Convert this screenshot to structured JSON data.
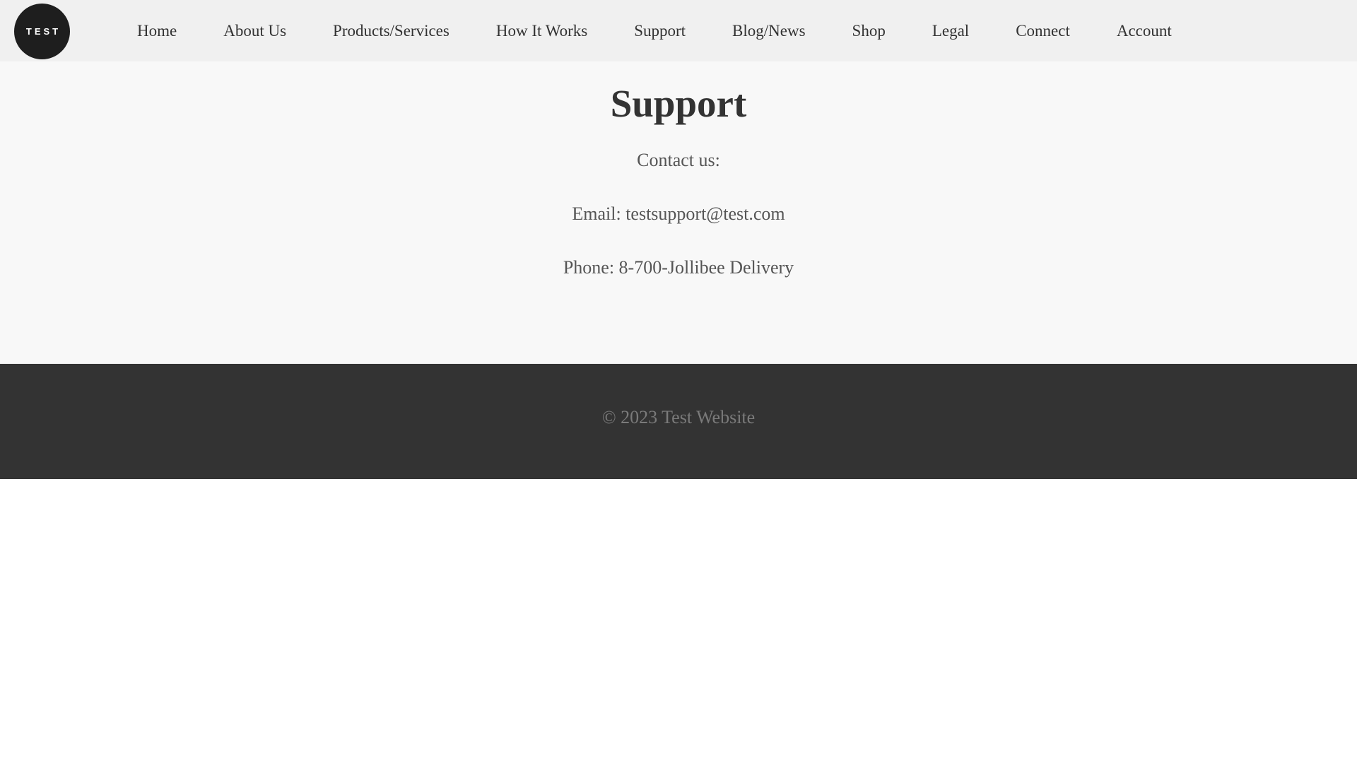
{
  "header": {
    "logo_text": "TEST",
    "nav": [
      {
        "label": "Home"
      },
      {
        "label": "About Us"
      },
      {
        "label": "Products/Services"
      },
      {
        "label": "How It Works"
      },
      {
        "label": "Support"
      },
      {
        "label": "Blog/News"
      },
      {
        "label": "Shop"
      },
      {
        "label": "Legal"
      },
      {
        "label": "Connect"
      },
      {
        "label": "Account"
      }
    ]
  },
  "main": {
    "title": "Support",
    "contact_heading": "Contact us:",
    "email_line": "Email: testsupport@test.com",
    "phone_line": "Phone: 8-700-Jollibee Delivery"
  },
  "footer": {
    "copyright": "© 2023 Test Website"
  },
  "colors": {
    "nav_background": "#f0f0f0",
    "main_background": "#f8f8f8",
    "footer_background": "#333333",
    "logo_background": "#1e1e1e"
  }
}
